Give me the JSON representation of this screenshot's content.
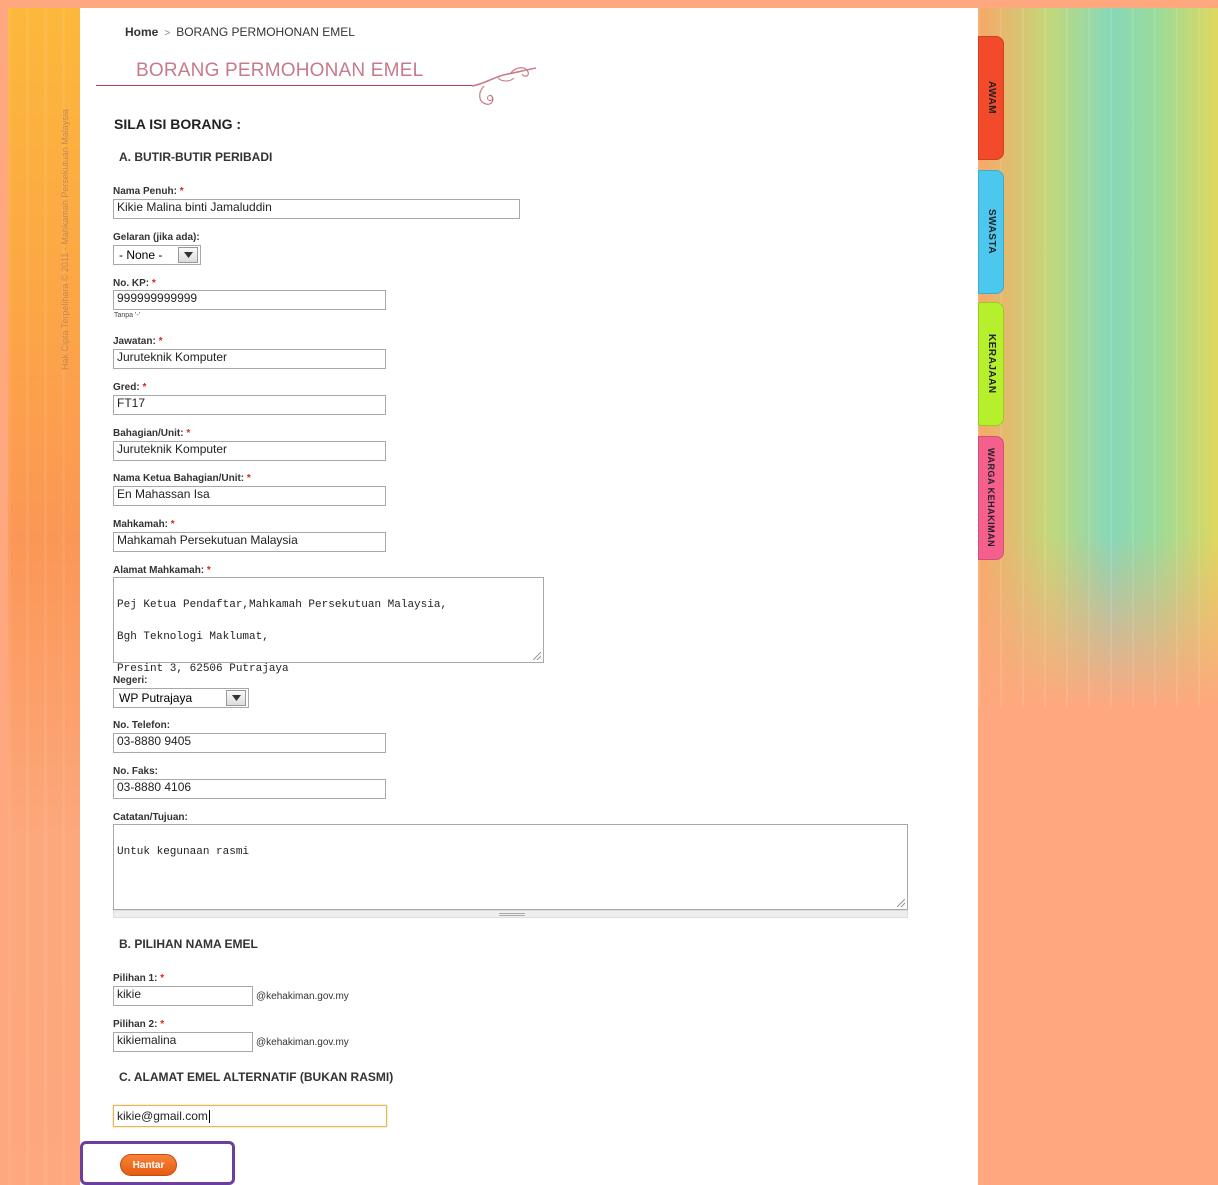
{
  "sidebar": {
    "copyright": "Hak Cipta Terpelihara © 2011 - Mahkamah Persekutuan Malaysia"
  },
  "side_tabs": [
    "AWAM",
    "SWASTA",
    "KERAJAAN",
    "WARGA KEHAKIMAN"
  ],
  "breadcrumb": {
    "home": "Home",
    "current": "BORANG PERMOHONAN EMEL"
  },
  "page_title": "BORANG PERMOHONAN EMEL",
  "form": {
    "heading": "SILA ISI BORANG :",
    "section_a": "A. BUTIR-BUTIR PERIBADI",
    "required_mark": "*",
    "nama_penuh": {
      "label": "Nama Penuh:",
      "value": "Kikie Malina binti Jamaluddin"
    },
    "gelaran": {
      "label": "Gelaran (jika ada):",
      "value": "- None -"
    },
    "no_kp": {
      "label": "No. KP:",
      "value": "999999999999",
      "hint": "Tanpa '-'"
    },
    "jawatan": {
      "label": "Jawatan:",
      "value": "Juruteknik Komputer"
    },
    "gred": {
      "label": "Gred:",
      "value": "FT17"
    },
    "bahagian": {
      "label": "Bahagian/Unit:",
      "value": "Juruteknik Komputer"
    },
    "ketua": {
      "label": "Nama Ketua Bahagian/Unit:",
      "value": "En Mahassan Isa"
    },
    "mahkamah": {
      "label": "Mahkamah:",
      "value": "Mahkamah Persekutuan Malaysia"
    },
    "alamat": {
      "label": "Alamat Mahkamah:",
      "lines": [
        "Pej Ketua Pendaftar,Mahkamah Persekutuan Malaysia,",
        "Bgh Teknologi Maklumat,",
        "Presint 3, 62506 Putrajaya"
      ]
    },
    "negeri": {
      "label": "Negeri:",
      "value": "WP Putrajaya"
    },
    "telefon": {
      "label": "No. Telefon:",
      "value": "03-8880  9405"
    },
    "faks": {
      "label": "No. Faks:",
      "value": "03-8880 4106"
    },
    "catatan": {
      "label": "Catatan/Tujuan:",
      "value": "Untuk kegunaan rasmi"
    },
    "section_b": "B. PILIHAN NAMA EMEL",
    "pilihan1": {
      "label": "Pilihan 1:",
      "value": "kikie",
      "domain": "@kehakiman.gov.my"
    },
    "pilihan2": {
      "label": "Pilihan 2:",
      "value": "kikiemalina",
      "domain": "@kehakiman.gov.my"
    },
    "section_c": "C. ALAMAT EMEL ALTERNATIF (BUKAN RASMI)",
    "alt_email": {
      "value": "kikie@gmail.com"
    },
    "submit_label": "Hantar"
  },
  "colors": {
    "accent": "#e55c10",
    "title": "#c77a8a",
    "highlight": "#6a3fa0",
    "tab_awam": "#f24a2a",
    "tab_swasta": "#4cc8ef",
    "tab_kerajaan": "#b6ef2c",
    "tab_warga": "#f45f8c"
  }
}
